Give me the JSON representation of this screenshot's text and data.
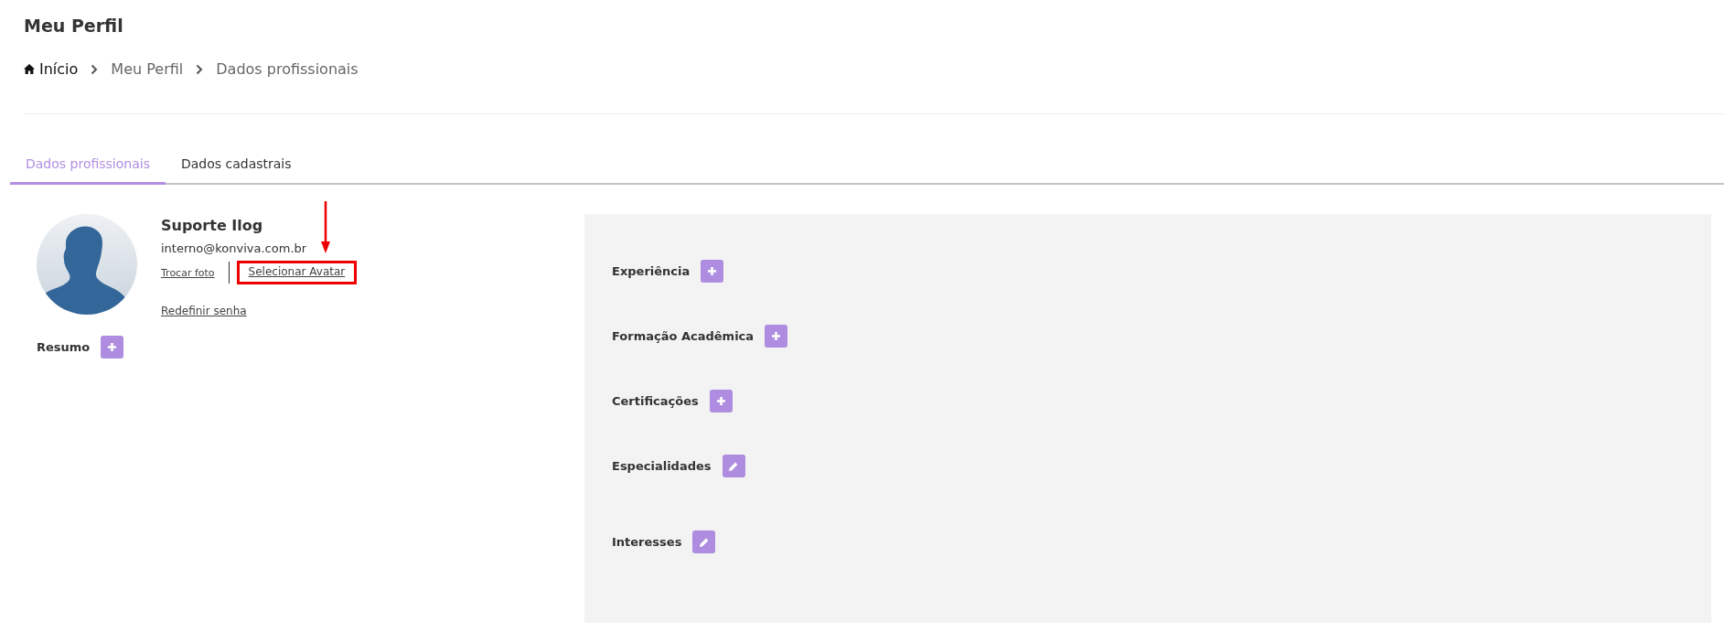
{
  "page_title": "Meu Perfil",
  "breadcrumb": [
    {
      "label": "Início",
      "kind": "home"
    },
    {
      "label": "Meu Perfil",
      "kind": "link"
    },
    {
      "label": "Dados profissionais",
      "kind": "current"
    }
  ],
  "tabs": [
    {
      "label": "Dados profissionais",
      "selected": true
    },
    {
      "label": "Dados cadastrais",
      "selected": false
    }
  ],
  "profile": {
    "name": "Suporte Ilog",
    "email": "interno@konviva.com.br",
    "change_photo": "Trocar foto",
    "select_avatar": "Selecionar Avatar",
    "select_avatar_highlighted": true,
    "reset_password": "Redefinir senha"
  },
  "summary": {
    "label": "Resumo",
    "kind": "add"
  },
  "sections": [
    {
      "label": "Experiência",
      "kind": "add"
    },
    {
      "label": "Formação Acadêmica",
      "kind": "add"
    },
    {
      "label": "Certificações",
      "kind": "add"
    },
    {
      "label": "Especialidades",
      "kind": "edit"
    },
    {
      "label": "Interesses",
      "kind": "edit"
    }
  ]
}
